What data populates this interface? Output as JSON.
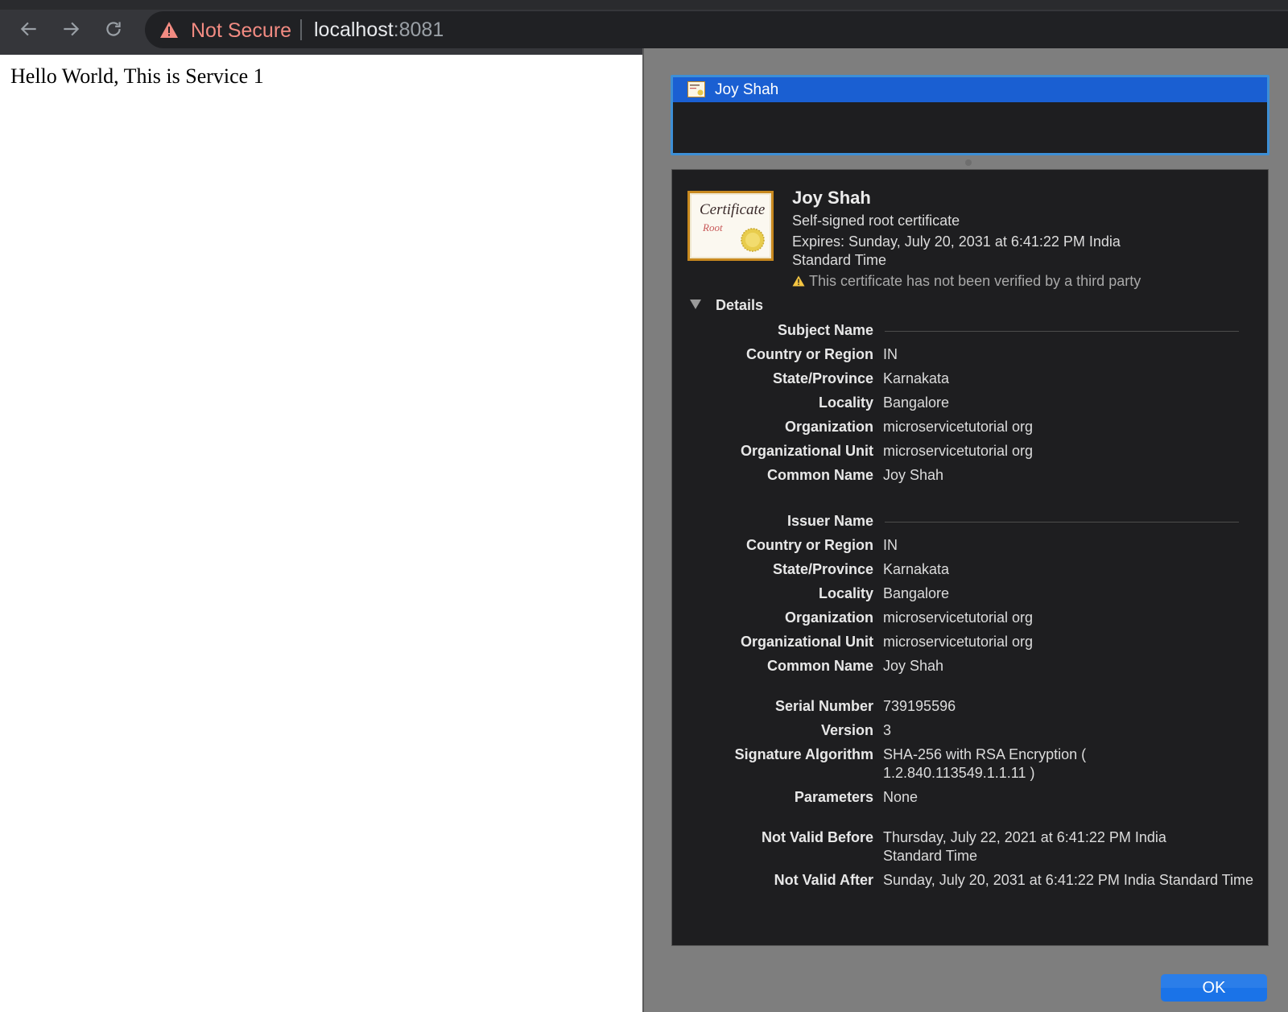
{
  "browser": {
    "security_label": "Not Secure",
    "url_host": "localhost",
    "url_port": ":8081"
  },
  "page": {
    "text": "Hello World, This is Service 1"
  },
  "cert_list": {
    "selected_item": "Joy Shah"
  },
  "certificate": {
    "name": "Joy Shah",
    "kind": "Self-signed root certificate",
    "expires": "Expires: Sunday, July 20, 2031 at 6:41:22 PM India Standard Time",
    "warning": "This certificate has not been verified by a third party",
    "icon_text": "Certificate",
    "icon_subtext": "Root"
  },
  "details": {
    "toggle_label": "Details",
    "subject": {
      "heading": "Subject Name",
      "rows": [
        {
          "k": "Country or Region",
          "v": "IN"
        },
        {
          "k": "State/Province",
          "v": "Karnakata"
        },
        {
          "k": "Locality",
          "v": "Bangalore"
        },
        {
          "k": "Organization",
          "v": "microservicetutorial org"
        },
        {
          "k": "Organizational Unit",
          "v": "microservicetutorial org"
        },
        {
          "k": "Common Name",
          "v": "Joy Shah"
        }
      ]
    },
    "issuer": {
      "heading": "Issuer Name",
      "rows": [
        {
          "k": "Country or Region",
          "v": "IN"
        },
        {
          "k": "State/Province",
          "v": "Karnakata"
        },
        {
          "k": "Locality",
          "v": "Bangalore"
        },
        {
          "k": "Organization",
          "v": "microservicetutorial org"
        },
        {
          "k": "Organizational Unit",
          "v": "microservicetutorial org"
        },
        {
          "k": "Common Name",
          "v": "Joy Shah"
        }
      ]
    },
    "serial_number": {
      "k": "Serial Number",
      "v": "739195596"
    },
    "version": {
      "k": "Version",
      "v": "3"
    },
    "signature_algorithm": {
      "k": "Signature Algorithm",
      "v": "SHA-256 with RSA Encryption ( 1.2.840.113549.1.1.11 )"
    },
    "parameters": {
      "k": "Parameters",
      "v": "None"
    },
    "not_valid_before": {
      "k": "Not Valid Before",
      "v": "Thursday, July 22, 2021 at 6:41:22 PM India Standard Time"
    },
    "not_valid_after": {
      "k": "Not Valid After",
      "v": "Sunday, July 20, 2031 at 6:41:22 PM India Standard Time"
    }
  },
  "dialog": {
    "ok_label": "OK"
  },
  "colors": {
    "selection": "#1a5fd2",
    "ok_button": "#1a73e8",
    "not_secure": "#f28b82",
    "panel_bg": "#1e1e20"
  }
}
